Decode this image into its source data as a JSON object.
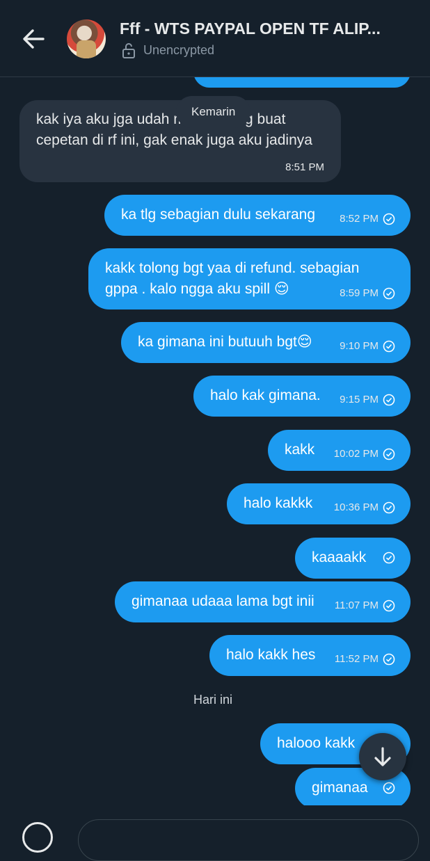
{
  "header": {
    "title": "Fff - WTS PAYPAL OPEN TF ALIP...",
    "encryption_status": "Unencrypted"
  },
  "chat": {
    "floating_date_label": "Kemarin",
    "incoming": [
      {
        "text": "kak iya aku jga udah minta tolong buat cepetan di rf ini, gak enak juga aku jadinya",
        "time": "8:51 PM"
      }
    ],
    "outgoing": [
      {
        "text": "ka tlg sebagian dulu sekarang",
        "time": "8:52 PM"
      },
      {
        "text": "kakk tolong bgt yaa di refund. sebagian gppa . kalo ngga aku spill 😌",
        "time": "8:59 PM"
      },
      {
        "text": "ka gimana ini butuuh bgt😌",
        "time": "9:10 PM"
      },
      {
        "text": "halo kak gimana.",
        "time": "9:15 PM"
      },
      {
        "text": "kakk",
        "time": "10:02 PM"
      },
      {
        "text": "halo kakkk",
        "time": "10:36 PM"
      },
      {
        "text": "kaaaakk",
        "time": ""
      },
      {
        "text": "gimanaa udaaa lama bgt inii",
        "time": "11:07 PM"
      },
      {
        "text": "halo kakk hes",
        "time": "11:52 PM"
      }
    ],
    "today_label": "Hari ini",
    "today_outgoing": [
      {
        "text": "halooo kakk"
      },
      {
        "text": "gimanaa"
      }
    ]
  },
  "icons": {
    "back": "arrow-left-icon",
    "lock": "lock-open-icon",
    "sent": "check-circle-icon",
    "scroll_down": "arrow-down-icon",
    "add": "plus-circle-icon"
  },
  "colors": {
    "background": "#15202b",
    "outgoing_bubble": "#1d9bf0",
    "incoming_bubble": "#283340"
  }
}
